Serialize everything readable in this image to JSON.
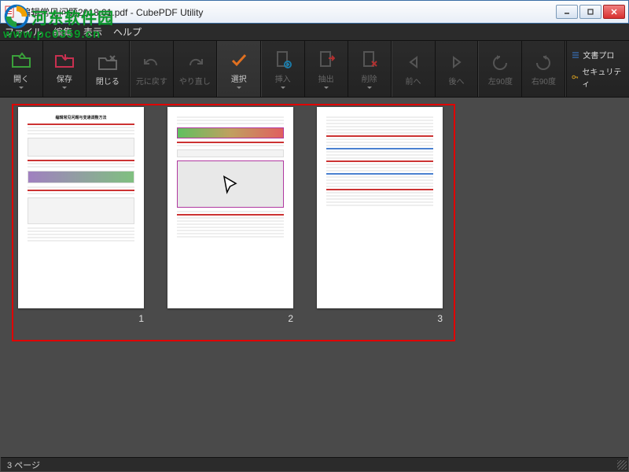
{
  "window": {
    "title": "编辑常见问题2018.01.pdf - CubePDF Utility"
  },
  "menubar": {
    "file": "ファイル",
    "edit": "編集",
    "view": "表示",
    "help": "ヘルプ"
  },
  "toolbar": {
    "open": "開く",
    "save": "保存",
    "close": "閉じる",
    "undo": "元に戻す",
    "redo": "やり直し",
    "select": "選択",
    "insert": "挿入",
    "extract": "抽出",
    "delete": "削除",
    "prev": "前へ",
    "next": "後へ",
    "rotate_left": "左90度",
    "rotate_right": "右90度",
    "doc_prop": "文書プロ",
    "security": "セキュリティ"
  },
  "pages": {
    "count": 3,
    "labels": [
      "1",
      "2",
      "3"
    ]
  },
  "status": {
    "text": "3 ページ"
  },
  "watermark": {
    "line1": "河东软件园",
    "line2": "www.pc0359.cn"
  }
}
